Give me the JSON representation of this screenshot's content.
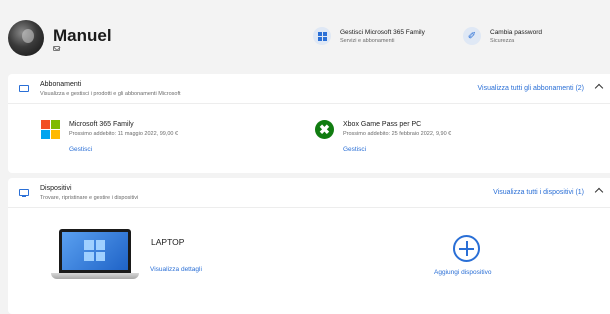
{
  "user": {
    "name": "Manuel"
  },
  "quick_actions": [
    {
      "title": "Gestisci Microsoft 365 Family",
      "subtitle": "Servizi e abbonamenti",
      "icon": "grid-icon"
    },
    {
      "title": "Cambia password",
      "subtitle": "Sicurezza",
      "icon": "key-icon"
    }
  ],
  "subscriptions": {
    "title": "Abbonamenti",
    "subtitle": "Visualizza e gestisci i prodotti e gli abbonamenti Microsoft",
    "view_all": "Visualizza tutti gli abbonamenti (2)",
    "manage_label": "Gestisci",
    "items": [
      {
        "name": "Microsoft 365 Family",
        "detail": "Prossimo addebito: 11 maggio 2022, 99,00 €",
        "icon": "microsoft-logo-icon"
      },
      {
        "name": "Xbox Game Pass per PC",
        "detail": "Prossimo addebito: 25 febbraio 2022, 9,90 €",
        "icon": "xbox-logo-icon"
      }
    ]
  },
  "devices": {
    "title": "Dispositivi",
    "subtitle": "Trovare, ripristinare e gestire i dispositivi",
    "view_all": "Visualizza tutti i dispositivi (1)",
    "device_name": "LAPTOP",
    "device_link": "Visualizza dettagli",
    "add_label": "Aggiungi dispositivo"
  },
  "colors": {
    "accent": "#2a6fd6",
    "background": "#f3f3f3",
    "card": "#ffffff",
    "xbox": "#107c10",
    "ms_red": "#f25022",
    "ms_green": "#7fba00",
    "ms_blue": "#00a4ef",
    "ms_yellow": "#ffb900"
  }
}
